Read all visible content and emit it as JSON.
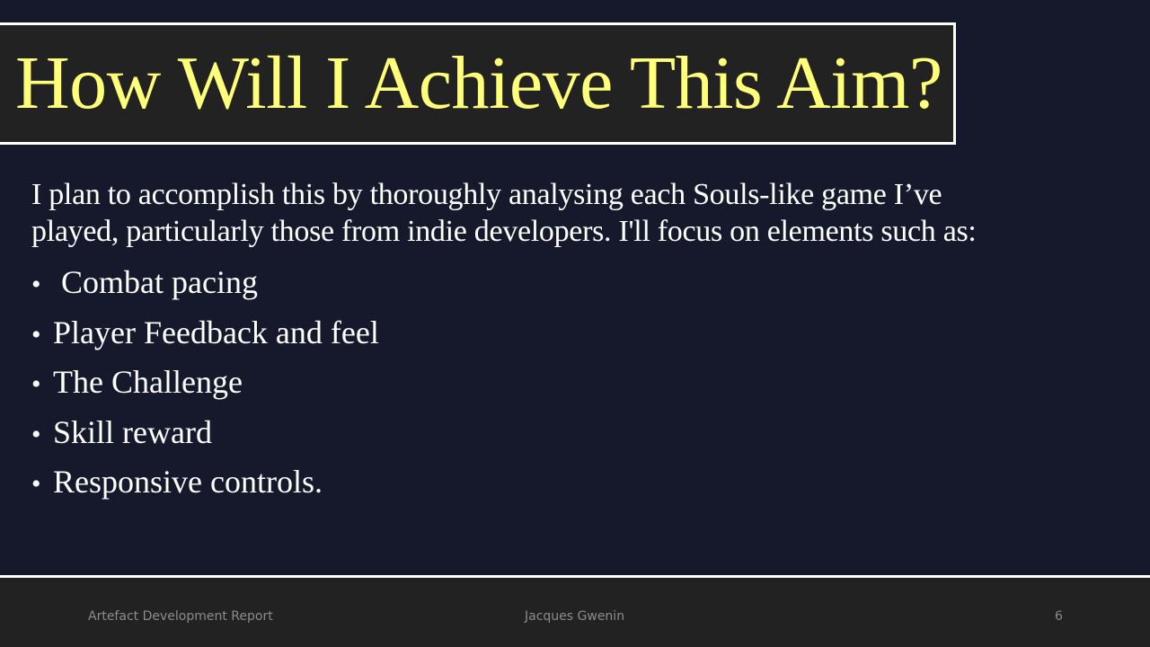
{
  "slide": {
    "title": "How Will I Achieve This Aim?",
    "intro": "I plan to accomplish this by thoroughly analysing each Souls-like game I’ve played, particularly those from indie developers. I'll focus on elements such as:",
    "bullet_char": "•",
    "bullets": [
      " Combat pacing",
      "Player Feedback and feel",
      "The Challenge",
      "Skill reward",
      "Responsive controls."
    ]
  },
  "footer": {
    "left": "Artefact Development Report",
    "center": "Jacques Gwenin",
    "page_number": "6"
  },
  "colors": {
    "background": "#15192b",
    "title_text": "#ffff7a",
    "title_box": "#222222",
    "body_text": "#ffffff",
    "footer_bg": "#222222",
    "footer_text": "#8c8c8c"
  }
}
